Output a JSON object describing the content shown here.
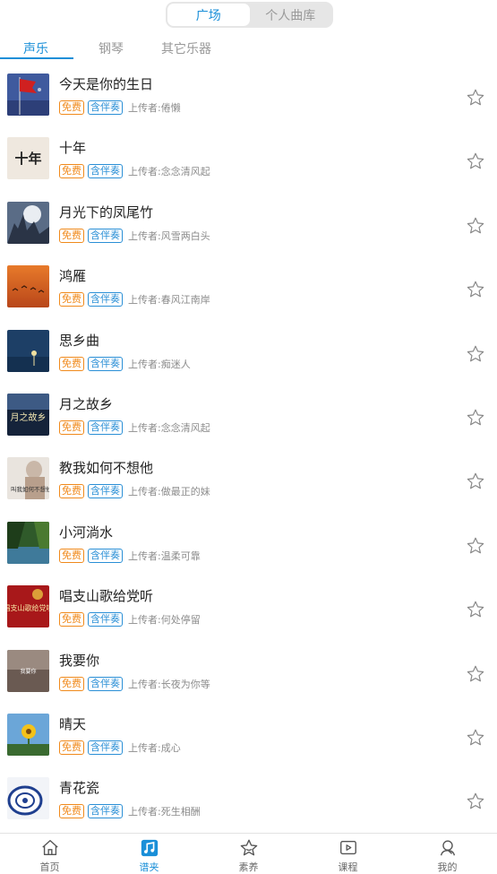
{
  "segment": {
    "plaza": "广场",
    "personal": "个人曲库"
  },
  "tabs": [
    "声乐",
    "钢琴",
    "其它乐器"
  ],
  "tag_free": "免费",
  "tag_accompaniment": "含伴奏",
  "uploader_prefix": "上传者:",
  "songs": [
    {
      "title": "今天是你的生日",
      "uploader": "倦懒"
    },
    {
      "title": "十年",
      "uploader": "念念清风起"
    },
    {
      "title": "月光下的凤尾竹",
      "uploader": "风雪两白头"
    },
    {
      "title": "鸿雁",
      "uploader": "春风江南岸"
    },
    {
      "title": "思乡曲",
      "uploader": "痴迷人"
    },
    {
      "title": "月之故乡",
      "uploader": "念念清风起"
    },
    {
      "title": "教我如何不想他",
      "uploader": "做最正的妹"
    },
    {
      "title": "小河淌水",
      "uploader": "温柔可靠"
    },
    {
      "title": "唱支山歌给党听",
      "uploader": "何处停留"
    },
    {
      "title": "我要你",
      "uploader": "长夜为你等"
    },
    {
      "title": "晴天",
      "uploader": "成心"
    },
    {
      "title": "青花瓷",
      "uploader": "死生相酬"
    }
  ],
  "thumb_text": {
    "shinian": "十年",
    "yuezhiguxiang": "月之故乡",
    "jiaowo": "叫我如何不想他",
    "changzhi": "唱支山歌给党听",
    "woyaoni": "我要你"
  },
  "nav": [
    {
      "label": "首页",
      "icon": "home-icon"
    },
    {
      "label": "谱夹",
      "icon": "music-note-icon"
    },
    {
      "label": "素养",
      "icon": "star-icon"
    },
    {
      "label": "课程",
      "icon": "play-icon"
    },
    {
      "label": "我的",
      "icon": "person-icon"
    }
  ],
  "colors": {
    "accent": "#1a8fd8",
    "free": "#f08a1c",
    "accompaniment": "#2a8fd6"
  }
}
